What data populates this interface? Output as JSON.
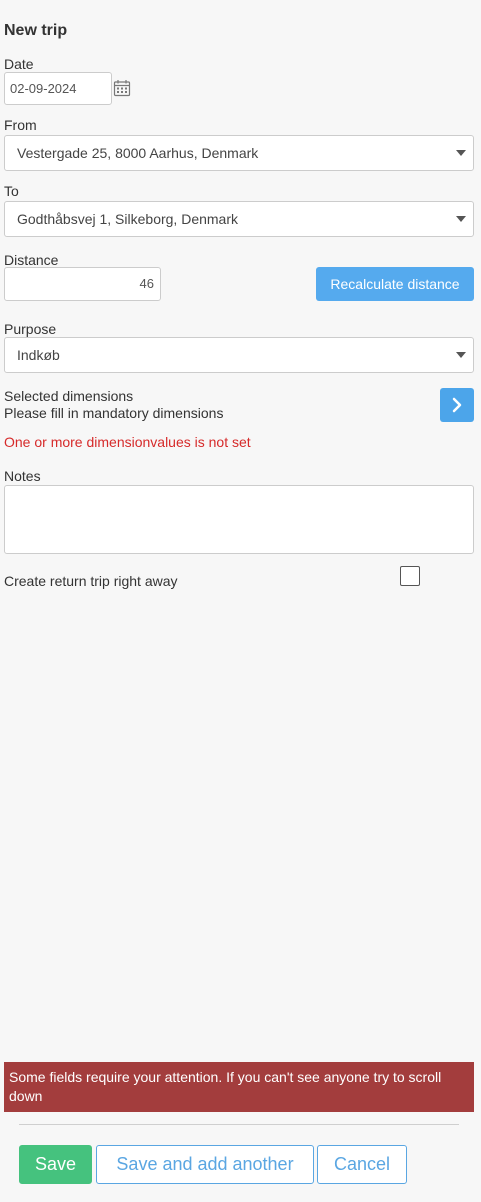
{
  "form": {
    "title": "New trip",
    "date": {
      "label": "Date",
      "value": "02-09-2024",
      "icon": "calendar-icon"
    },
    "from": {
      "label": "From",
      "value": "Vestergade 25, 8000 Aarhus, Denmark"
    },
    "to": {
      "label": "To",
      "value": "Godthåbsvej 1, Silkeborg, Denmark"
    },
    "distance": {
      "label": "Distance",
      "value": "46",
      "recalc_label": "Recalculate distance"
    },
    "purpose": {
      "label": "Purpose",
      "value": "Indkøb"
    },
    "dimensions": {
      "title": "Selected dimensions",
      "hint": "Please fill in mandatory dimensions",
      "error": "One or more dimensionvalues is not set",
      "icon": "chevron-right-icon"
    },
    "notes": {
      "label": "Notes",
      "value": ""
    },
    "return_trip": {
      "label": "Create return trip right away",
      "checked": false
    }
  },
  "alert": {
    "message": "Some fields require your attention. If you can't see anyone try to scroll down"
  },
  "actions": {
    "save_label": "Save",
    "save_add_label": "Save and add another",
    "cancel_label": "Cancel"
  },
  "colors": {
    "primary": "#55aaee",
    "success": "#45c27e",
    "error_text": "#d62a2a",
    "alert_bg": "#a33d3d"
  }
}
